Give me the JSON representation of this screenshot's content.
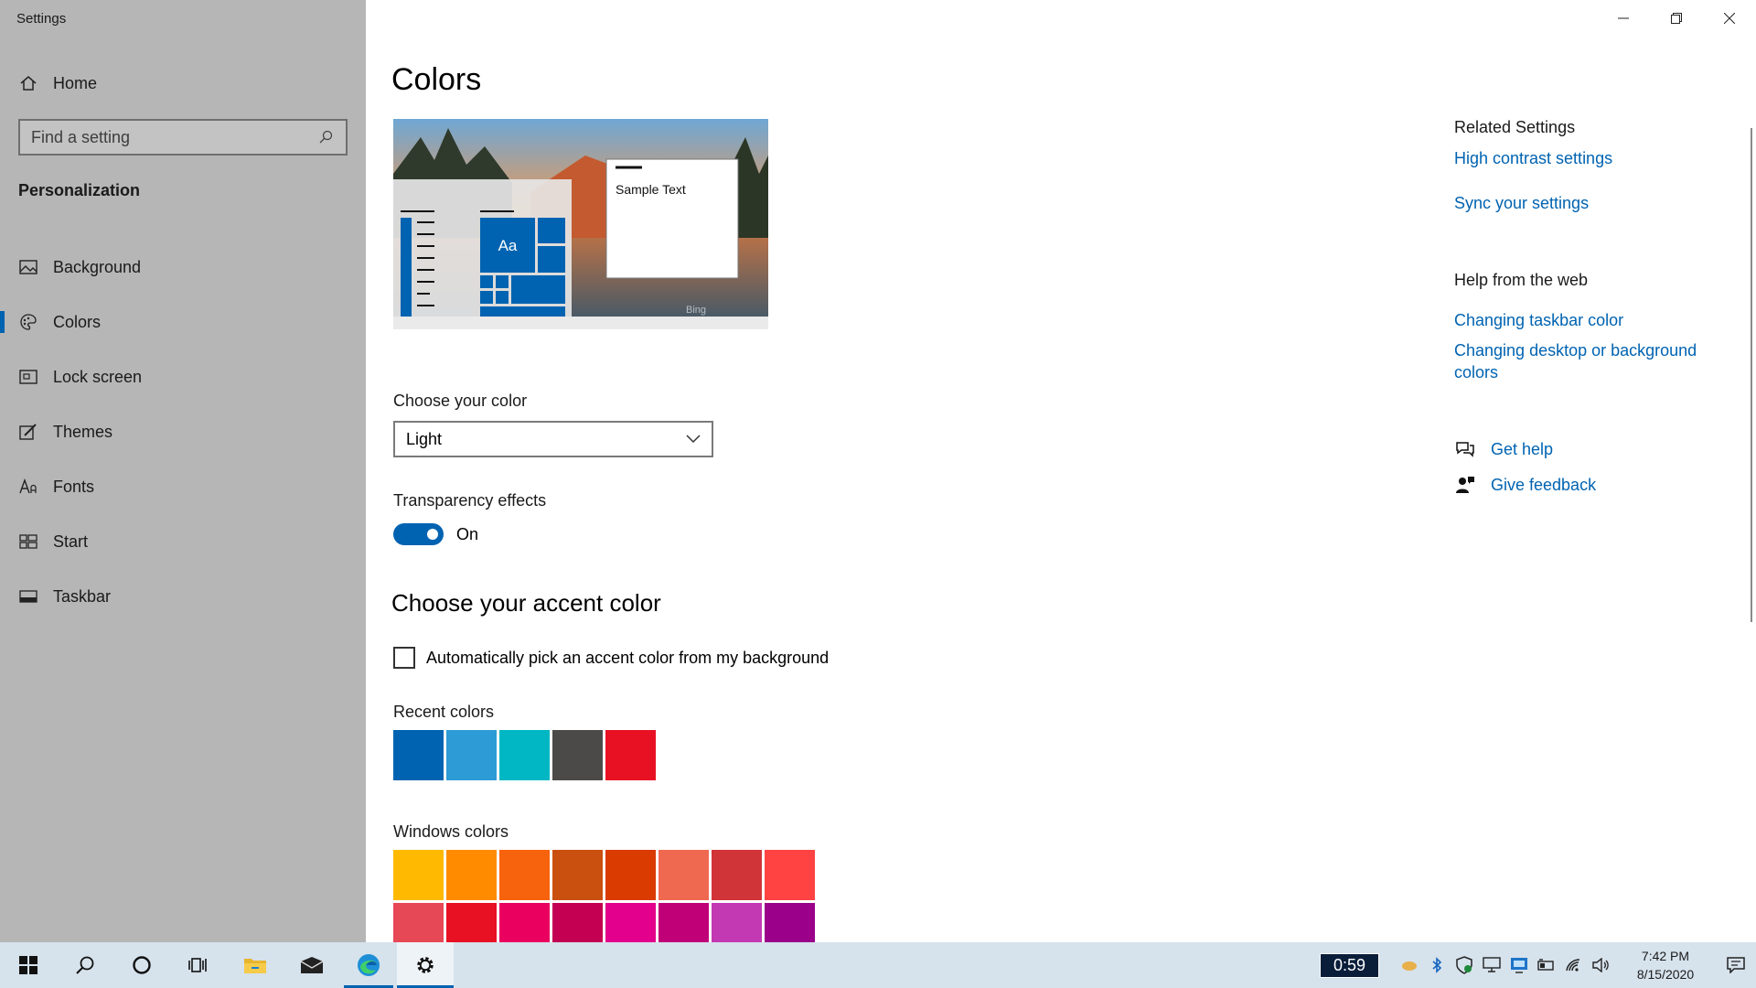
{
  "window": {
    "title": "Settings"
  },
  "sidebar": {
    "home_label": "Home",
    "search_placeholder": "Find a setting",
    "section_heading": "Personalization",
    "items": [
      {
        "label": "Background",
        "icon": "picture-icon"
      },
      {
        "label": "Colors",
        "icon": "palette-icon",
        "selected": true
      },
      {
        "label": "Lock screen",
        "icon": "lock-screen-icon"
      },
      {
        "label": "Themes",
        "icon": "brush-icon"
      },
      {
        "label": "Fonts",
        "icon": "font-icon"
      },
      {
        "label": "Start",
        "icon": "start-icon"
      },
      {
        "label": "Taskbar",
        "icon": "taskbar-icon"
      }
    ]
  },
  "main": {
    "title": "Colors",
    "preview": {
      "sample_text": "Sample Text",
      "tile_text": "Aa",
      "watermark": "Bing"
    },
    "choose_color": {
      "label": "Choose your color",
      "value": "Light"
    },
    "transparency": {
      "label": "Transparency effects",
      "state": "On"
    },
    "accent_heading": "Choose your accent color",
    "auto_pick_label": "Automatically pick an accent color from my background",
    "recent_colors_label": "Recent colors",
    "recent_colors": [
      "#0063b1",
      "#2d9bd6",
      "#00b7c3",
      "#4c4a48",
      "#e81123"
    ],
    "windows_colors_label": "Windows colors",
    "windows_colors": [
      [
        "#ffb900",
        "#ff8c00",
        "#f7630c",
        "#ca5010",
        "#da3b01",
        "#ef6950",
        "#d13438",
        "#ff4343"
      ],
      [
        "#e74856",
        "#e81123",
        "#ea005e",
        "#c30052",
        "#e3008c",
        "#bf0077",
        "#c239b3",
        "#9a0089"
      ]
    ]
  },
  "related": {
    "heading": "Related Settings",
    "links": [
      "High contrast settings",
      "Sync your settings"
    ],
    "web_heading": "Help from the web",
    "web_links": [
      "Changing taskbar color",
      "Changing desktop or background colors"
    ],
    "get_help": "Get help",
    "give_feedback": "Give feedback"
  },
  "taskbar": {
    "timer": "0:59",
    "time": "7:42 PM",
    "date": "8/15/2020"
  },
  "colors": {
    "accent": "#0063b1",
    "sidebar_bg": "#b6b6b6",
    "taskbar_bg": "#d6e2ec"
  }
}
